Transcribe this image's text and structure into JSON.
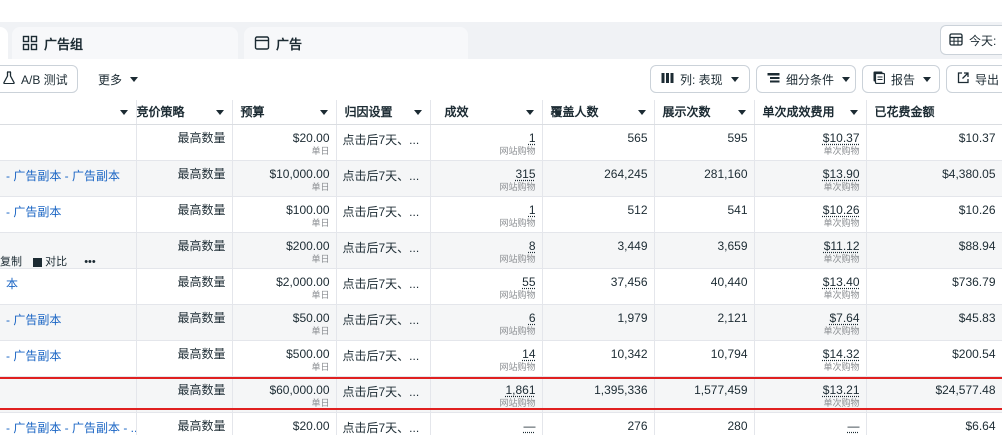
{
  "tabs": {
    "ad_set": "广告组",
    "ad": "广告"
  },
  "today_label": "今天:",
  "toolbar": {
    "ab_test": "A/B 测试",
    "more": "更多",
    "columns": "列: 表现",
    "breakdown": "细分条件",
    "reports": "报告",
    "export": "导出"
  },
  "columns": [
    "竞价策略",
    "预算",
    "归因设置",
    "成效",
    "覆盖人数",
    "展示次数",
    "单次成效费用",
    "已花费金额"
  ],
  "row_actions": {
    "duplicate": "复制",
    "compare": "对比",
    "more": "•••"
  },
  "rows": [
    {
      "name": "",
      "bid": "最高数量",
      "budget": "$20.00",
      "budget_sub": "单日",
      "attr": "点击后7天、...",
      "results": "1",
      "results_sub": "网站购物",
      "reach": "565",
      "impr": "595",
      "cpr": "$10.37",
      "cpr_sub": "单次购物",
      "spent": "$10.37"
    },
    {
      "name": "- 广告副本 - 广告副本",
      "bid": "最高数量",
      "budget": "$10,000.00",
      "budget_sub": "单日",
      "attr": "点击后7天、...",
      "results": "315",
      "results_sub": "网站购物",
      "reach": "264,245",
      "impr": "281,160",
      "cpr": "$13.90",
      "cpr_sub": "单次购物",
      "spent": "$4,380.05"
    },
    {
      "name": "- 广告副本",
      "bid": "最高数量",
      "budget": "$100.00",
      "budget_sub": "单日",
      "attr": "点击后7天、...",
      "results": "1",
      "results_sub": "网站购物",
      "reach": "512",
      "impr": "541",
      "cpr": "$10.26",
      "cpr_sub": "单次购物",
      "spent": "$10.26"
    },
    {
      "name": "",
      "bid": "最高数量",
      "budget": "$200.00",
      "budget_sub": "单日",
      "attr": "点击后7天、...",
      "results": "8",
      "results_sub": "网站购物",
      "reach": "3,449",
      "impr": "3,659",
      "cpr": "$11.12",
      "cpr_sub": "单次购物",
      "spent": "$88.94"
    },
    {
      "name": "本",
      "bid": "最高数量",
      "budget": "$2,000.00",
      "budget_sub": "单日",
      "attr": "点击后7天、...",
      "results": "55",
      "results_sub": "网站购物",
      "reach": "37,456",
      "impr": "40,440",
      "cpr": "$13.40",
      "cpr_sub": "单次购物",
      "spent": "$736.79"
    },
    {
      "name": "- 广告副本",
      "bid": "最高数量",
      "budget": "$50.00",
      "budget_sub": "单日",
      "attr": "点击后7天、...",
      "results": "6",
      "results_sub": "网站购物",
      "reach": "1,979",
      "impr": "2,121",
      "cpr": "$7.64",
      "cpr_sub": "单次购物",
      "spent": "$45.83"
    },
    {
      "name": "- 广告副本",
      "bid": "最高数量",
      "budget": "$500.00",
      "budget_sub": "单日",
      "attr": "点击后7天、...",
      "results": "14",
      "results_sub": "网站购物",
      "reach": "10,342",
      "impr": "10,794",
      "cpr": "$14.32",
      "cpr_sub": "单次购物",
      "spent": "$200.54"
    },
    {
      "name": "",
      "bid": "最高数量",
      "budget": "$60,000.00",
      "budget_sub": "单日",
      "attr": "点击后7天、...",
      "results": "1,861",
      "results_sub": "网站购物",
      "reach": "1,395,336",
      "impr": "1,577,459",
      "cpr": "$13.21",
      "cpr_sub": "单次购物",
      "spent": "$24,577.48"
    },
    {
      "name": "- 广告副本 - 广告副本 - ...",
      "bid": "最高数量",
      "budget": "$20.00",
      "budget_sub": "",
      "attr": "点击后7天、...",
      "results": "—",
      "results_sub": "",
      "reach": "276",
      "impr": "280",
      "cpr": "—",
      "cpr_sub": "",
      "spent": "$6.64"
    }
  ],
  "colors": {
    "link": "#1a65c4",
    "highlight": "#e02020"
  }
}
